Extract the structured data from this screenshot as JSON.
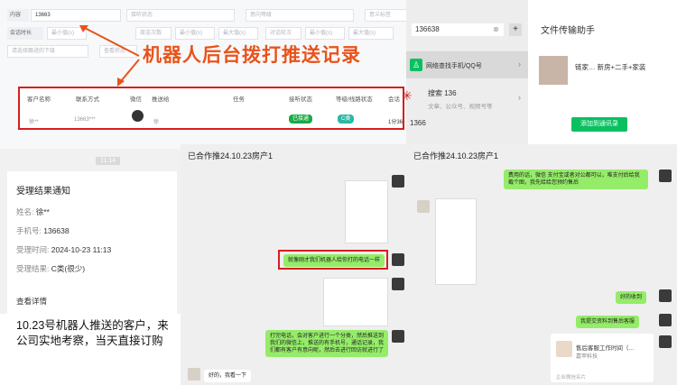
{
  "admin": {
    "filters_row1": [
      {
        "label": "内容",
        "value": "13663"
      },
      {
        "label": "",
        "value": "接听状态"
      },
      {
        "label": "",
        "value": "意向等级"
      },
      {
        "label": "",
        "value": "意义标签"
      },
      {
        "label": "",
        "value": "开始日期 — 结束日期"
      }
    ],
    "filters_row2": [
      {
        "label": "会话时长",
        "value": "最小值(s)"
      },
      {
        "label": "",
        "value": "接送次数"
      },
      {
        "label": "",
        "value": "最小值(s)"
      },
      {
        "label": "",
        "value": "最大值(s)"
      },
      {
        "label": "",
        "value": "对话轮次"
      },
      {
        "label": "",
        "value": "最小值(s)"
      },
      {
        "label": "",
        "value": "最大值(s)"
      }
    ],
    "filters_row3": [
      {
        "label": "",
        "value": "请选择跟进的下级"
      },
      {
        "label": "",
        "value": "查看状态"
      }
    ],
    "headline": "机器人后台拨打推送记录",
    "table": {
      "headers": [
        "客户名称",
        "联系方式",
        "微信",
        "推送给",
        "任务",
        "接听状态",
        "等级/线路状态",
        "会话"
      ],
      "row": {
        "name": "徐**",
        "phone": "13663***",
        "pusher": "徐",
        "status": "已接通",
        "grade": "C类",
        "duration": "1分36"
      }
    }
  },
  "search": {
    "query": "136638",
    "plus": "+",
    "item1": "网络查找手机/QQ号",
    "item2_title": "搜索 136",
    "item2_sub": "文章、公众号、视频号等",
    "item3": "1366"
  },
  "contact": {
    "title": "文件传输助手",
    "desc": "链家… 新房+二手+家装",
    "button": "添加到通讯录"
  },
  "notice": {
    "time": "11:14",
    "title": "受理结果通知",
    "name_label": "姓名:",
    "name": "徐**",
    "phone_label": "手机号:",
    "phone": "136638",
    "date_label": "受理时间:",
    "date": "2024-10-23 11:13",
    "result_label": "受理结果:",
    "result": "C类(很少)",
    "detail": "查看详情",
    "caption": "10.23号机器人推送的客户，来公司实地考察，当天直接订购"
  },
  "chat1": {
    "title": "已合作推24.10.23房产1",
    "msg_red": "就像刚才我们机器人给你打的电话一样",
    "msg_long": "打完电话，会对客户进行一个分类，然后推送到我们的微信上，推送的有手机号，通话记录，我们都有客户有意向呢，然后去进行回访就进行了",
    "msg_left": "好的，我看一下"
  },
  "chat2": {
    "title": "已合作推24.10.23房产1",
    "msg1": "费用的话，微信 支付宝或者对公都可以，唯支付后给我截个图，我先给给您预约售后",
    "msg2": "好的收到",
    "msg3": "我提交资料到售后客服",
    "card_title": "售后客服工作时间（…",
    "card_sub": "嘉甲科技",
    "card_footer": "企业微信名片"
  }
}
